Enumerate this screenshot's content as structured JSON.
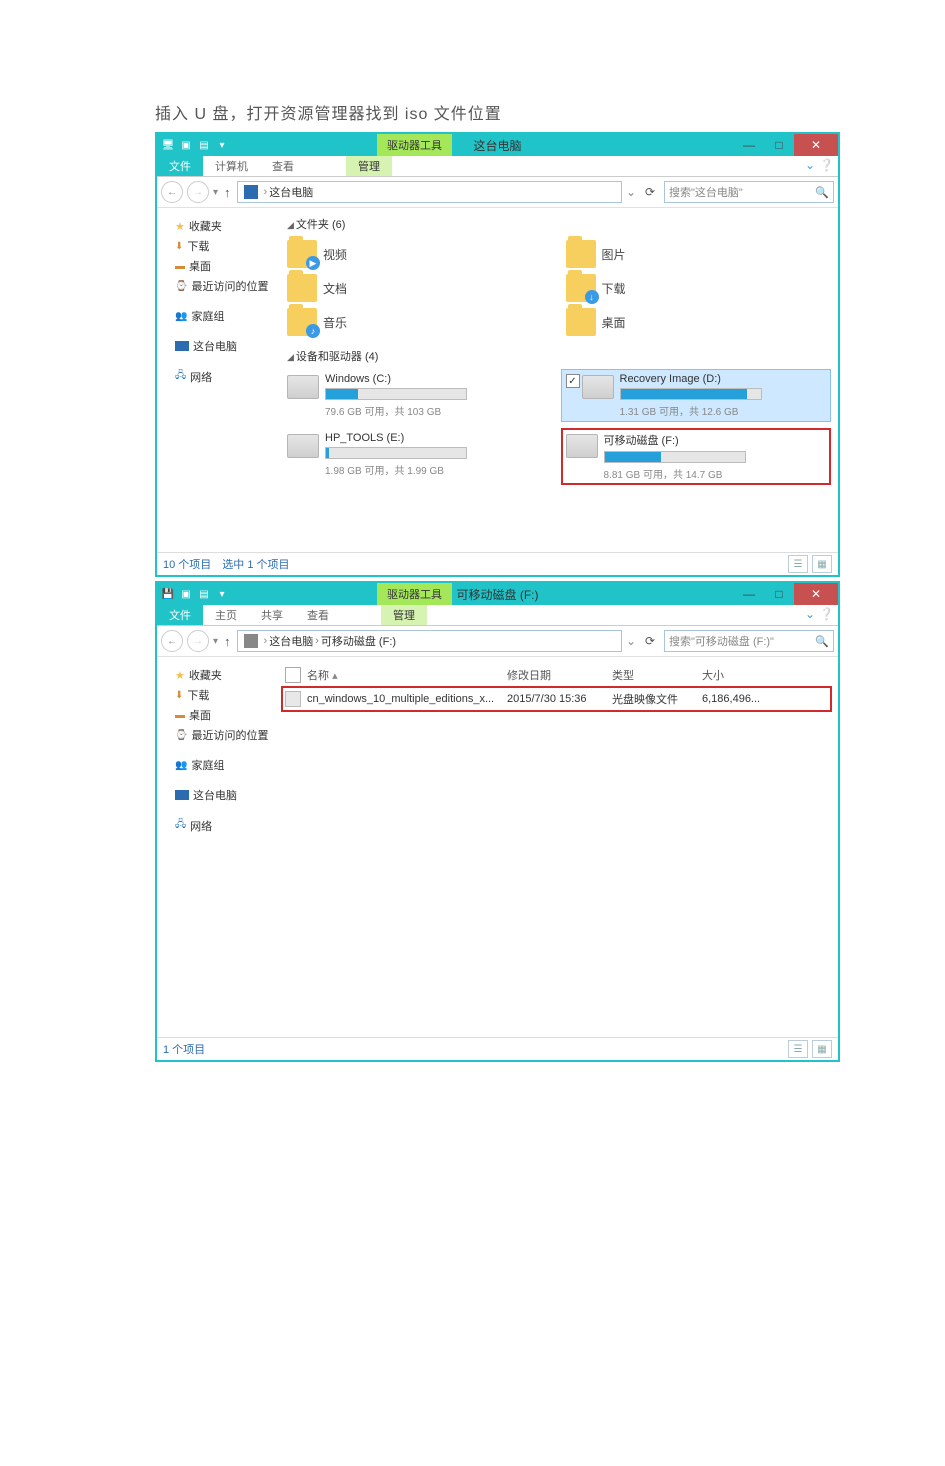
{
  "instruction": "插入 U 盘，打开资源管理器找到 iso 文件位置",
  "win1": {
    "title": "这台电脑",
    "tool_tab": "驱动器工具",
    "ribbon": {
      "file": "文件",
      "computer": "计算机",
      "view": "查看",
      "manage": "管理"
    },
    "breadcrumb": {
      "root": "这台电脑"
    },
    "search_ph": "搜索\"这台电脑\"",
    "nav": {
      "fav": "收藏夹",
      "downloads": "下载",
      "desktop": "桌面",
      "recent": "最近访问的位置",
      "homegroup": "家庭组",
      "thispc": "这台电脑",
      "network": "网络"
    },
    "folders_header": "文件夹 (6)",
    "folders": [
      {
        "name": "视频",
        "ov": "▶"
      },
      {
        "name": "图片",
        "ov": ""
      },
      {
        "name": "文档",
        "ov": ""
      },
      {
        "name": "下载",
        "ov": "↓"
      },
      {
        "name": "音乐",
        "ov": "♪"
      },
      {
        "name": "桌面",
        "ov": ""
      }
    ],
    "drives_header": "设备和驱动器 (4)",
    "drives": {
      "c": {
        "title": "Windows (C:)",
        "free": "79.6 GB 可用，共 103 GB",
        "pct": 23
      },
      "d": {
        "title": "Recovery Image (D:)",
        "free": "1.31 GB 可用，共 12.6 GB",
        "pct": 90,
        "selected": true,
        "checked": true
      },
      "e": {
        "title": "HP_TOOLS (E:)",
        "free": "1.98 GB 可用，共 1.99 GB",
        "pct": 2
      },
      "f": {
        "title": "可移动磁盘 (F:)",
        "free": "8.81 GB 可用，共 14.7 GB",
        "pct": 40,
        "highlight": true
      }
    },
    "status_left": "10 个项目　选中 1 个项目"
  },
  "win2": {
    "title": "可移动磁盘 (F:)",
    "tool_tab": "驱动器工具",
    "ribbon": {
      "file": "文件",
      "home": "主页",
      "share": "共享",
      "view": "查看",
      "manage": "管理"
    },
    "breadcrumb": {
      "root": "这台电脑",
      "leaf": "可移动磁盘 (F:)"
    },
    "search_ph": "搜索\"可移动磁盘 (F:)\"",
    "nav": {
      "fav": "收藏夹",
      "downloads": "下载",
      "desktop": "桌面",
      "recent": "最近访问的位置",
      "homegroup": "家庭组",
      "thispc": "这台电脑",
      "network": "网络"
    },
    "cols": {
      "name": "名称",
      "date": "修改日期",
      "type": "类型",
      "size": "大小"
    },
    "row": {
      "name": "cn_windows_10_multiple_editions_x...",
      "date": "2015/7/30 15:36",
      "type": "光盘映像文件",
      "size": "6,186,496..."
    },
    "status_left": "1 个项目"
  }
}
